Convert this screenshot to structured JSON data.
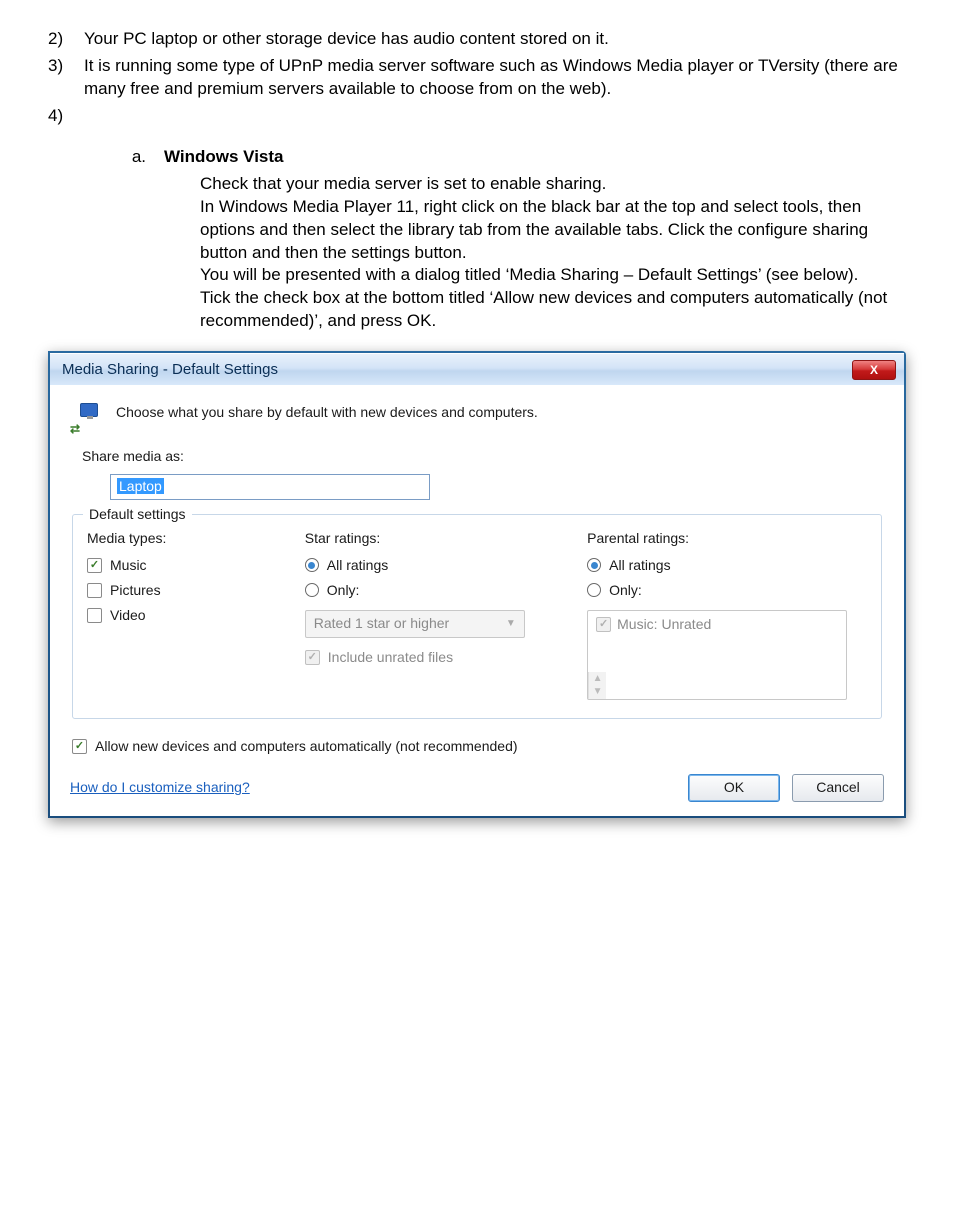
{
  "list": {
    "item2_num": "2)",
    "item2": "Your PC laptop or other storage device has audio content stored on it.",
    "item3_num": "3)",
    "item3": "It is running some type of UPnP media server software such as Windows Media player or TVersity (there are many free and premium servers available to choose from on the web).",
    "item4_num": "4)",
    "sub_a_id": "a.",
    "sub_a_title": "Windows Vista",
    "sub_a_p1": "Check that your media server is set to enable sharing.",
    "sub_a_p2": "In Windows Media Player 11, right click on the black bar at the top and select tools, then options and then select the library tab from the available tabs. Click the configure sharing button and then the settings button.",
    "sub_a_p3": "You will be presented with a dialog titled ‘Media Sharing – Default Settings’ (see below).",
    "sub_a_p4": "Tick the check box at the bottom titled ‘Allow new devices and computers automatically (not recommended)’, and press OK."
  },
  "dialog": {
    "title": "Media Sharing - Default Settings",
    "close": "X",
    "intro": "Choose what you share by default with new devices and computers.",
    "share_as_label": "Share media as:",
    "share_as_value": "Laptop",
    "group_legend": "Default settings",
    "media_types_h": "Media types:",
    "media_music": "Music",
    "media_pictures": "Pictures",
    "media_video": "Video",
    "star_h": "Star ratings:",
    "star_all": "All ratings",
    "star_only": "Only:",
    "star_combo": "Rated 1 star or higher",
    "star_unrated": "Include unrated files",
    "par_h": "Parental ratings:",
    "par_all": "All ratings",
    "par_only": "Only:",
    "par_list_item": "Music: Unrated",
    "allow_label": "Allow new devices and computers automatically (not recommended)",
    "help_link": "How do I customize sharing?",
    "ok": "OK",
    "cancel": "Cancel"
  }
}
